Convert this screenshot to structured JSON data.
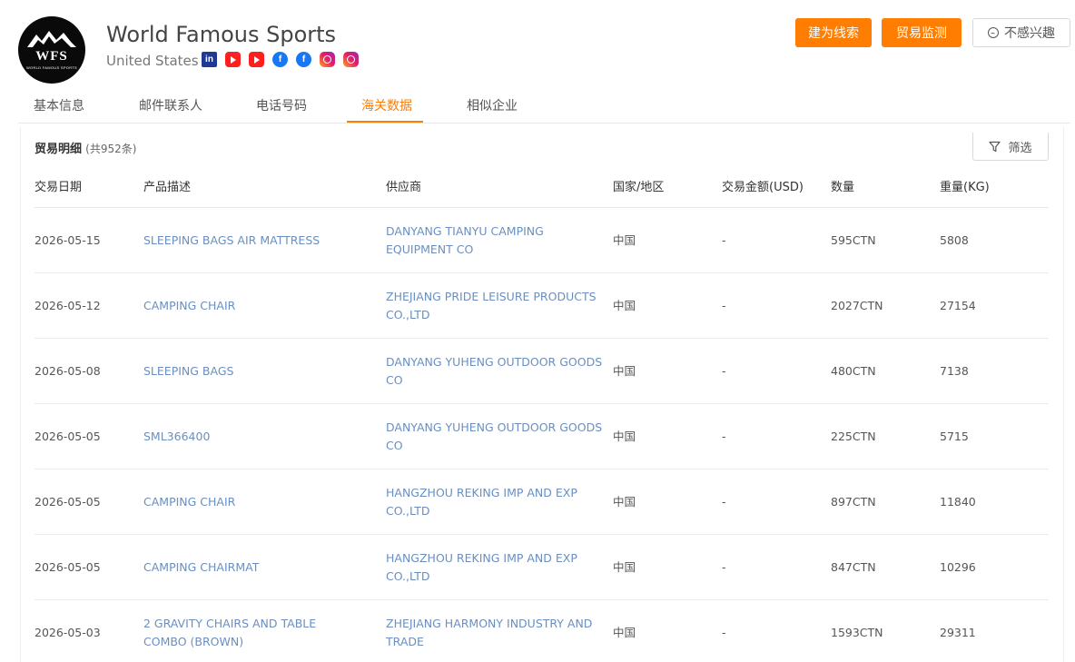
{
  "company": {
    "name": "World Famous Sports",
    "country": "United States",
    "logo_text": "WFS",
    "logo_subtext": "WORLD FAMOUS SPORTS",
    "socials": [
      "linkedin-icon",
      "youtube-icon",
      "youtube-icon",
      "facebook-icon",
      "facebook-icon",
      "instagram-icon",
      "instagram-icon"
    ]
  },
  "actions": {
    "lead_label": "建为线索",
    "monitor_label": "贸易监测",
    "not_interested_label": "不感兴趣"
  },
  "tabs": [
    {
      "label": "基本信息"
    },
    {
      "label": "邮件联系人"
    },
    {
      "label": "电话号码"
    },
    {
      "label": "海关数据"
    },
    {
      "label": "相似企业"
    }
  ],
  "active_tab": "海关数据",
  "trade": {
    "title": "贸易明细",
    "count": "(共952条)",
    "filter_label": "筛选",
    "columns": [
      "交易日期",
      "产品描述",
      "供应商",
      "国家/地区",
      "交易金额(USD)",
      "数量",
      "重量(KG)"
    ],
    "rows": [
      {
        "date": "2026-05-15",
        "product": "SLEEPING BAGS AIR MATTRESS",
        "supplier": "DANYANG TIANYU CAMPING EQUIPMENT CO",
        "country": "中国",
        "amount": "-",
        "qty": "595CTN",
        "weight": "5808"
      },
      {
        "date": "2026-05-12",
        "product": "CAMPING CHAIR",
        "supplier": "ZHEJIANG PRIDE LEISURE PRODUCTS CO.,LTD",
        "country": "中国",
        "amount": "-",
        "qty": "2027CTN",
        "weight": "27154"
      },
      {
        "date": "2026-05-08",
        "product": "SLEEPING BAGS",
        "supplier": "DANYANG YUHENG OUTDOOR GOODS CO",
        "country": "中国",
        "amount": "-",
        "qty": "480CTN",
        "weight": "7138"
      },
      {
        "date": "2026-05-05",
        "product": "SML366400",
        "supplier": "DANYANG YUHENG OUTDOOR GOODS CO",
        "country": "中国",
        "amount": "-",
        "qty": "225CTN",
        "weight": "5715"
      },
      {
        "date": "2026-05-05",
        "product": "CAMPING CHAIR",
        "supplier": "HANGZHOU REKING IMP AND EXP CO.,LTD",
        "country": "中国",
        "amount": "-",
        "qty": "897CTN",
        "weight": "11840"
      },
      {
        "date": "2026-05-05",
        "product": "CAMPING CHAIRMAT",
        "supplier": "HANGZHOU REKING IMP AND EXP CO.,LTD",
        "country": "中国",
        "amount": "-",
        "qty": "847CTN",
        "weight": "10296"
      },
      {
        "date": "2026-05-03",
        "product": "2 GRAVITY CHAIRS AND TABLE COMBO (BROWN)",
        "supplier": "ZHEJIANG HARMONY INDUSTRY AND TRADE",
        "country": "中国",
        "amount": "-",
        "qty": "1593CTN",
        "weight": "29311"
      }
    ]
  },
  "colors": {
    "accent": "#ff7d00",
    "link": "#6a8fc0"
  }
}
